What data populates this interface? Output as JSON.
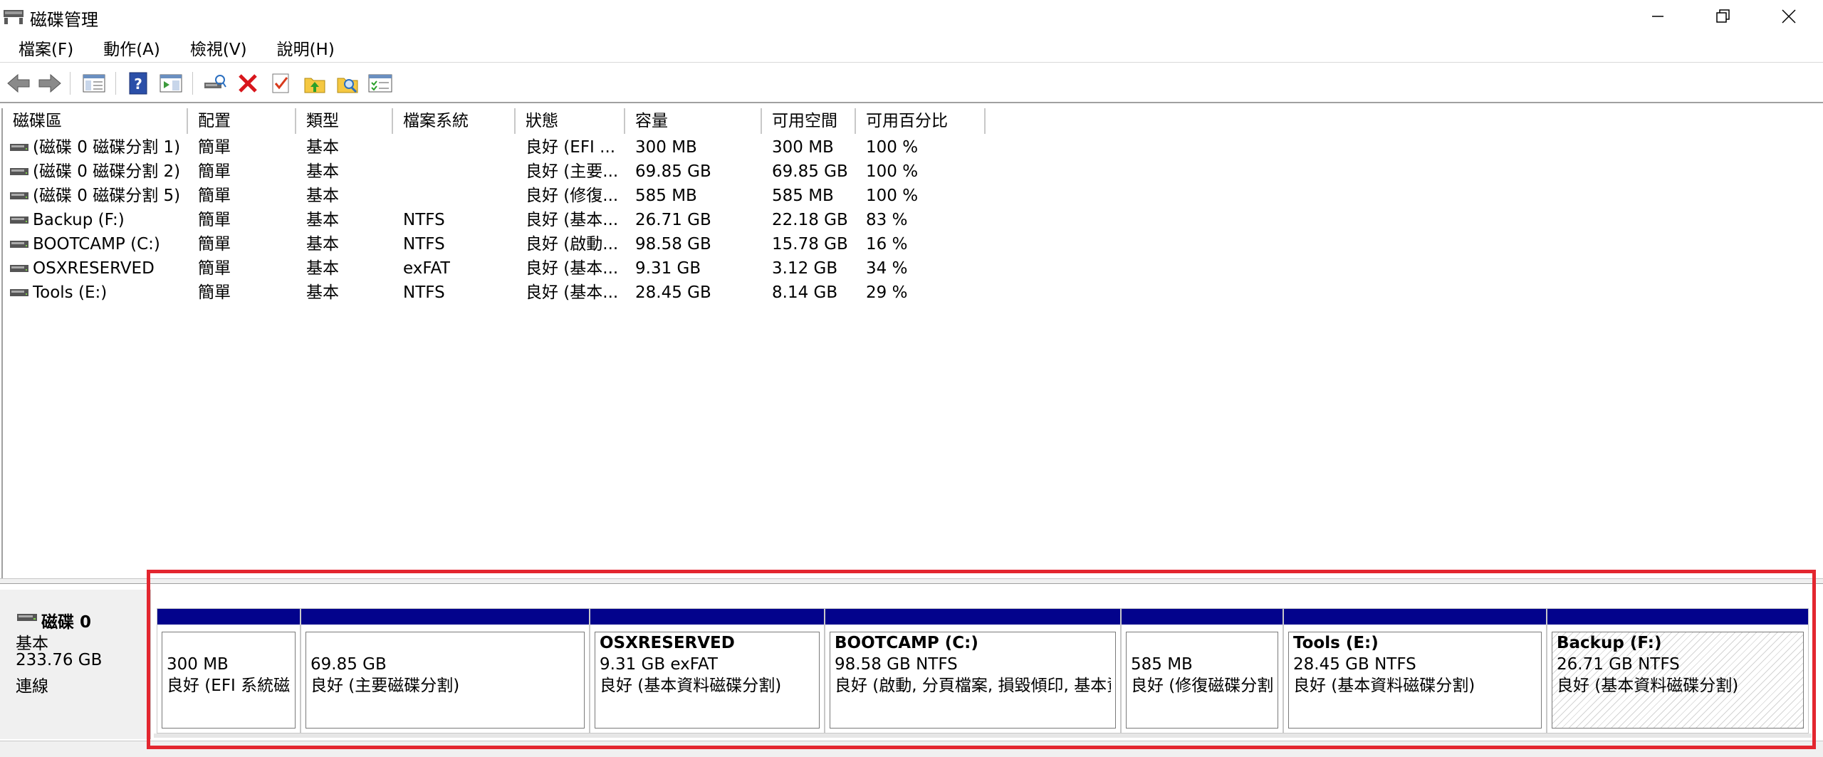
{
  "window": {
    "title": "磁碟管理"
  },
  "menu": [
    "檔案(F)",
    "動作(A)",
    "檢視(V)",
    "說明(H)"
  ],
  "toolbar": {
    "icons": [
      "back-arrow-icon",
      "forward-arrow-icon",
      "console-tree-icon",
      "help-icon",
      "action-pane-icon",
      "connect-disk-icon",
      "delete-icon",
      "check-properties-icon",
      "folder-up-icon",
      "search-folder-icon",
      "list-view-icon"
    ]
  },
  "columns": [
    "磁碟區",
    "配置",
    "類型",
    "檔案系統",
    "狀態",
    "容量",
    "可用空間",
    "可用百分比"
  ],
  "volumes": [
    {
      "name": "(磁碟 0 磁碟分割 1)",
      "layout": "簡單",
      "type": "基本",
      "fs": "",
      "status": "良好 (EFI ...",
      "capacity": "300 MB",
      "free": "300 MB",
      "pct": "100 %"
    },
    {
      "name": "(磁碟 0 磁碟分割 2)",
      "layout": "簡單",
      "type": "基本",
      "fs": "",
      "status": "良好 (主要...",
      "capacity": "69.85 GB",
      "free": "69.85 GB",
      "pct": "100 %"
    },
    {
      "name": "(磁碟 0 磁碟分割 5)",
      "layout": "簡單",
      "type": "基本",
      "fs": "",
      "status": "良好 (修復...",
      "capacity": "585 MB",
      "free": "585 MB",
      "pct": "100 %"
    },
    {
      "name": "Backup (F:)",
      "layout": "簡單",
      "type": "基本",
      "fs": "NTFS",
      "status": "良好 (基本...",
      "capacity": "26.71 GB",
      "free": "22.18 GB",
      "pct": "83 %"
    },
    {
      "name": "BOOTCAMP (C:)",
      "layout": "簡單",
      "type": "基本",
      "fs": "NTFS",
      "status": "良好 (啟動...",
      "capacity": "98.58 GB",
      "free": "15.78 GB",
      "pct": "16 %"
    },
    {
      "name": "OSXRESERVED",
      "layout": "簡單",
      "type": "基本",
      "fs": "exFAT",
      "status": "良好 (基本...",
      "capacity": "9.31 GB",
      "free": "3.12 GB",
      "pct": "34 %"
    },
    {
      "name": "Tools (E:)",
      "layout": "簡單",
      "type": "基本",
      "fs": "NTFS",
      "status": "良好 (基本...",
      "capacity": "28.45 GB",
      "free": "8.14 GB",
      "pct": "29 %"
    }
  ],
  "disk": {
    "name": "磁碟 0",
    "type": "基本",
    "size": "233.76 GB",
    "state": "連線",
    "partitions": [
      {
        "title": "",
        "size": "300 MB",
        "status": "良好 (EFI 系統磁碟分割)"
      },
      {
        "title": "",
        "size": "69.85 GB",
        "status": "良好 (主要磁碟分割)"
      },
      {
        "title": "OSXRESERVED",
        "size": "9.31 GB exFAT",
        "status": "良好 (基本資料磁碟分割)"
      },
      {
        "title": "BOOTCAMP  (C:)",
        "size": "98.58 GB NTFS",
        "status": "良好 (啟動, 分頁檔案, 損毀傾印, 基本資料磁碟分割)"
      },
      {
        "title": "",
        "size": "585 MB",
        "status": "良好 (修復磁碟分割)"
      },
      {
        "title": "Tools  (E:)",
        "size": "28.45 GB NTFS",
        "status": "良好 (基本資料磁碟分割)"
      },
      {
        "title": "Backup  (F:)",
        "size": "26.71 GB NTFS",
        "status": "良好 (基本資料磁碟分割)"
      }
    ]
  },
  "colors": {
    "partition_bar": "#03038c",
    "highlight": "#e3262f"
  }
}
